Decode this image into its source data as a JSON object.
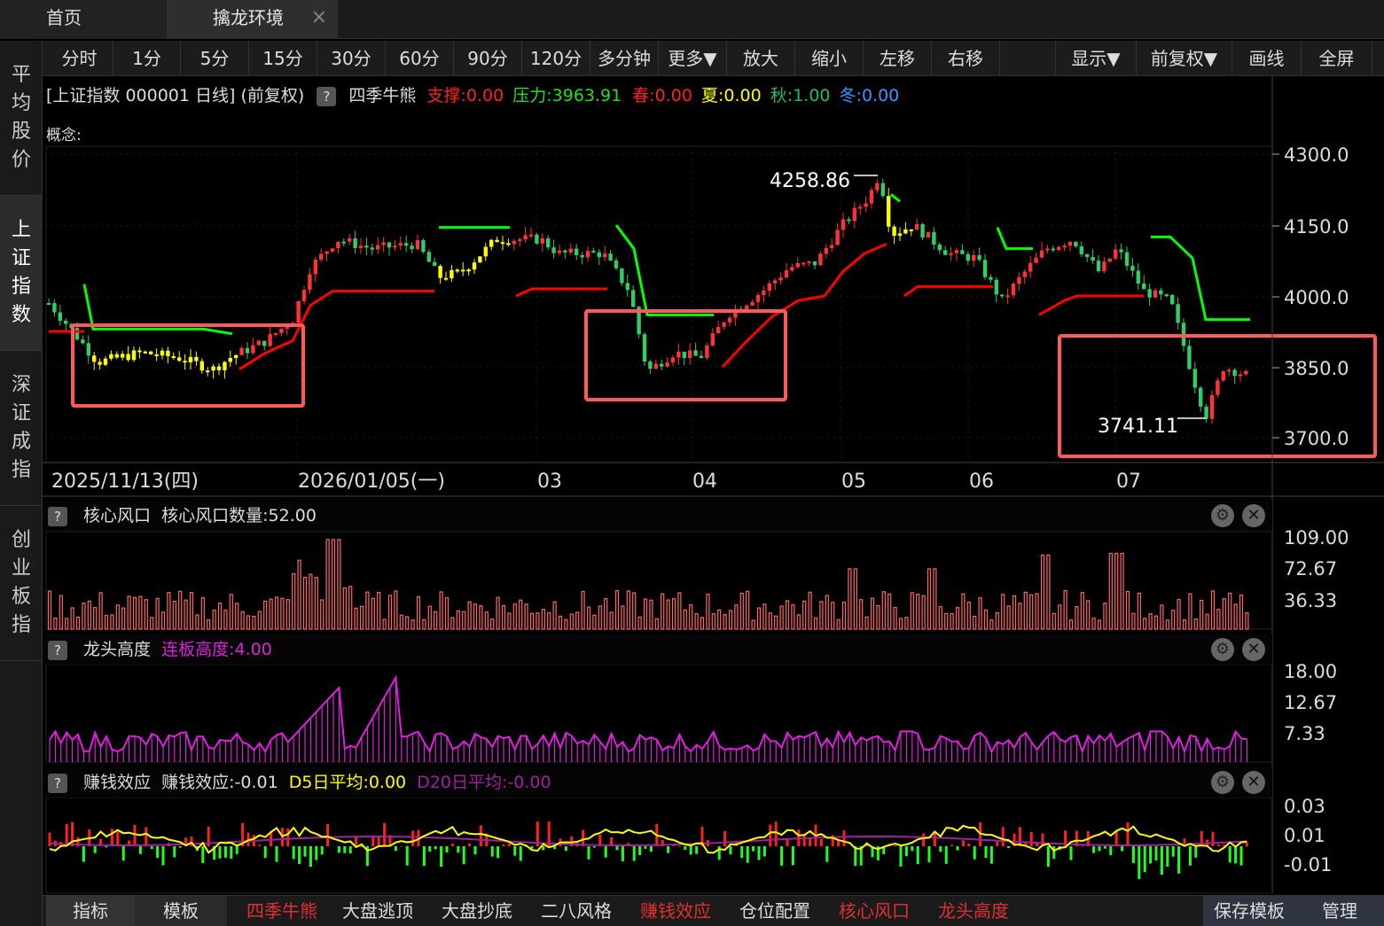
{
  "tabs": [
    {
      "label": "首页"
    },
    {
      "label": "擒龙环境",
      "close": "×"
    }
  ],
  "sidebar": {
    "items": [
      {
        "label": "平均股价",
        "chars": [
          "平",
          "均",
          "股",
          "价"
        ]
      },
      {
        "label": "上证指数",
        "chars": [
          "上",
          "证",
          "指",
          "数"
        ]
      },
      {
        "label": "深证成指",
        "chars": [
          "深",
          "证",
          "成",
          "指"
        ]
      },
      {
        "label": "创业板指",
        "chars": [
          "创",
          "业",
          "板",
          "指"
        ]
      }
    ]
  },
  "toolbar": {
    "periods": [
      "分时",
      "1分",
      "5分",
      "15分",
      "30分",
      "60分",
      "90分",
      "120分",
      "多分钟",
      "更多▼"
    ],
    "actions": [
      "放大",
      "缩小",
      "左移",
      "右移"
    ],
    "right": [
      "显示▼",
      "前复权▼",
      "画线",
      "全屏"
    ]
  },
  "info": {
    "title": "[上证指数 000001 日线]  (前复权)",
    "indicator": "四季牛熊",
    "support": "支撑:0.00",
    "pressure": "压力:3963.91",
    "spring": "春:0.00",
    "summer": "夏:0.00",
    "autumn": "秋:1.00",
    "winter": "冬:0.00",
    "qmark": "?"
  },
  "concept": "概念:",
  "main_chart": {
    "y_ticks": [
      "4300.0",
      "4150.0",
      "4000.0",
      "3850.0",
      "3700.0"
    ],
    "x_labels": [
      "2025/11/13(四)",
      "2026/01/05(一)",
      "03",
      "04",
      "05",
      "06",
      "07"
    ],
    "high_label": "4258.86",
    "low_label": "3741.11",
    "colors": {
      "up": "#ff3333",
      "down": "#33cc66",
      "yellow": "#ffff00",
      "support_line": "#ff0000",
      "pressure_line": "#00ff00",
      "highlight_box": "#ff5a5a"
    }
  },
  "panels": [
    {
      "title": "核心风口",
      "value": "核心风口数量:52.00",
      "y_ticks": [
        "109.00",
        "72.67",
        "36.33"
      ],
      "color": "#ff6666"
    },
    {
      "title": "龙头高度",
      "value": "连板高度:4.00",
      "y_ticks": [
        "18.00",
        "12.67",
        "7.33"
      ],
      "color": "#e020e0"
    },
    {
      "title": "赚钱效应",
      "value": "赚钱效应:-0.01",
      "d5": "D5日平均:0.00",
      "d20": "D20日平均:-0.00",
      "y_ticks": [
        "0.03",
        "0.01",
        "-0.01"
      ],
      "colors": {
        "pos": "#ff2020",
        "neg": "#20ff20",
        "d5": "#ffff00",
        "d20": "#a020a0"
      }
    }
  ],
  "bottom": {
    "left": [
      "指标",
      "模板"
    ],
    "items": [
      {
        "label": "四季牛熊",
        "color": "#e03030"
      },
      {
        "label": "大盘逃顶",
        "color": "#dddddd"
      },
      {
        "label": "大盘抄底",
        "color": "#dddddd"
      },
      {
        "label": "二八风格",
        "color": "#dddddd"
      },
      {
        "label": "赚钱效应",
        "color": "#e03030"
      },
      {
        "label": "仓位配置",
        "color": "#dddddd"
      },
      {
        "label": "核心风口",
        "color": "#e03030"
      },
      {
        "label": "龙头高度",
        "color": "#e03030"
      }
    ],
    "right": [
      "保存模板",
      "管理"
    ]
  }
}
